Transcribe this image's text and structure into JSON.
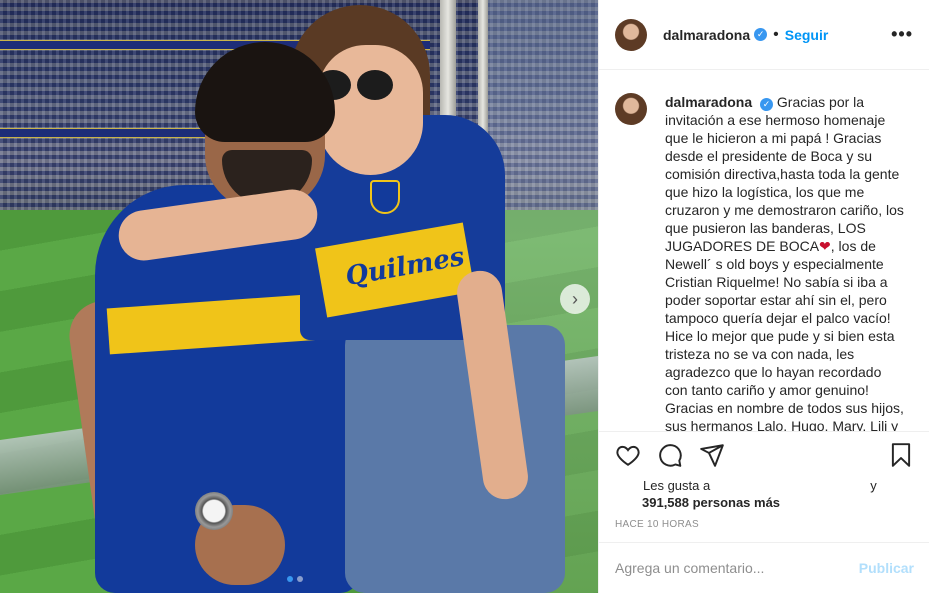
{
  "post": {
    "username": "dalmaradona",
    "verified_glyph": "✓",
    "follow_label": "Seguir",
    "separator": "•",
    "more_glyph": "•••",
    "caption_lines": [
      "Gracias por la",
      "invitación a ese hermoso homenaje",
      "que le hicieron a mi papá ! Gracias",
      "desde el presidente de Boca y su",
      "comisión directiva,hasta toda la gente",
      "que hizo la logística, los que me",
      "cruzaron y me demostraron cariño, los",
      "que pusieron las banderas, LOS",
      "JUGADORES DE BOCA",
      ", los de",
      "Newell´ s old boys y especialmente",
      "Cristian Riquelme! No sabía si iba a",
      "poder soportar estar ahí sin el, pero",
      "tampoco quería dejar el palco vacío!",
      "Hice lo mejor que pude y si bien esta",
      "tristeza no se va con nada, les",
      "agradezco que lo hayan recordado",
      "con tanto cariño y amor genuino!",
      "Gracias en nombre de todos sus hijos,",
      "sus hermanos Lalo, Hugo, Mary, Lili y"
    ],
    "heart_glyph": "❤",
    "likes_prefix": "Les gusta a",
    "likes_connector": "y",
    "likes_count": "391,588 personas más",
    "timestamp": "Hace 10 horas",
    "comment_placeholder": "Agrega un comentario...",
    "publish_label": "Publicar",
    "image": {
      "shirt_text": "Quilmes",
      "next_glyph": "›",
      "carousel_count": 2,
      "carousel_active": 0
    }
  },
  "colors": {
    "accent": "#0095f6",
    "verified": "#3897f0",
    "boca_blue": "#123a9b",
    "boca_gold": "#f0c419",
    "publish_disabled": "#b2dffc"
  },
  "icons": [
    "heart-icon",
    "comment-icon",
    "share-icon",
    "bookmark-icon",
    "verified-icon",
    "more-options-icon",
    "chevron-right-icon"
  ]
}
